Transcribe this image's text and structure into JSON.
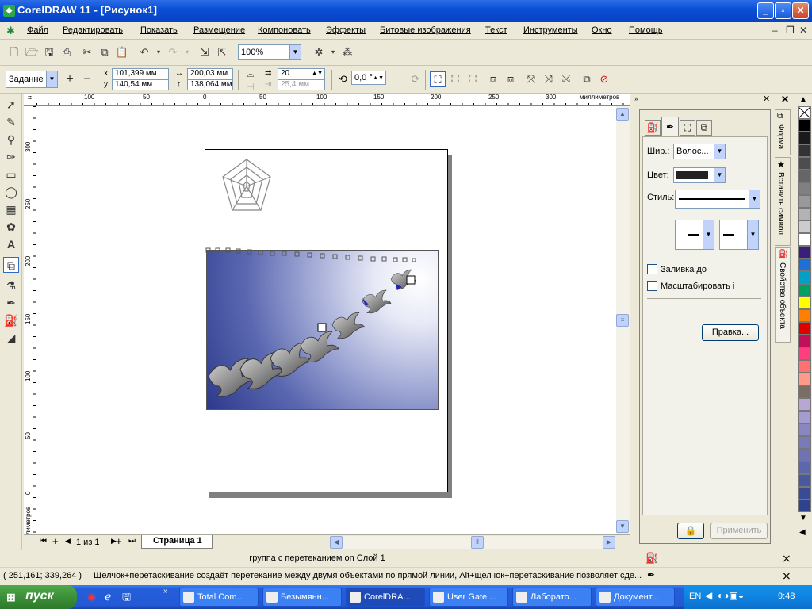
{
  "window": {
    "title": "CorelDRAW 11 - [Рисунок1]",
    "min": "_",
    "max": "▫",
    "close": "✕"
  },
  "menu": [
    "Файл",
    "Редактировать",
    "Показать",
    "Размещение",
    "Компоновать",
    "Эффекты",
    "Битовые изображения",
    "Текст",
    "Инструменты",
    "Окно",
    "Помощь"
  ],
  "toolbar": {
    "zoom": "100%"
  },
  "propbar": {
    "preset": "Заданне",
    "x_label": "x:",
    "x": "101,399 мм",
    "y_label": "y:",
    "y": "140,54 мм",
    "width": "200,03 мм",
    "height": "138,064 мм",
    "steps": "20",
    "spacing": "25,4 мм",
    "rotation": "0,0",
    "rotation_unit": "°"
  },
  "ruler": {
    "unit": "миллиметров",
    "h_ticks": [
      "100",
      "50",
      "0",
      "50",
      "100",
      "150",
      "200",
      "250",
      "300"
    ],
    "v_ticks": [
      "300",
      "250",
      "200",
      "150",
      "100",
      "50",
      "0"
    ],
    "v_unit": "миллиметров"
  },
  "pagebar": {
    "count": "1 из 1",
    "tab": "Страница 1"
  },
  "docker": {
    "width_label": "Шир.:",
    "width_value": "Волос...",
    "color_label": "Цвет:",
    "style_label": "Стиль:",
    "fill_label": "Заливка до",
    "scale_label": "Масштабировать і",
    "edit_button": "Правка...",
    "apply_button": "Применить",
    "tabs": [
      "Форма",
      "Вставить символ",
      "Свойства объекта"
    ]
  },
  "palette": [
    "#ffffff",
    "#000000",
    "#1a1a1a",
    "#333333",
    "#4d4d4d",
    "#666666",
    "#808080",
    "#999999",
    "#b3b3b3",
    "#cccccc",
    "#ffffff",
    "#3a1f7a",
    "#1f6fd6",
    "#00a0c8",
    "#00a060",
    "#ffff00",
    "#ff8000",
    "#e00000",
    "#c0105a",
    "#ff3d7f",
    "#ff7070",
    "#ff9a8a",
    "#7a6e64",
    "#b8a6d4",
    "#a49ccf",
    "#8a86c2",
    "#7a7ab8",
    "#6f73b3",
    "#5d67ac",
    "#4a589f",
    "#3a4b95",
    "#2f428c"
  ],
  "status": {
    "object": "группа с перетеканием on Слой 1",
    "coords": "( 251,161; 339,264 )",
    "hint": "Щелчок+перетаскивание создаёт перетекание между двумя объектами по прямой линии, Alt+щелчок+перетаскивание позволяет сде..."
  },
  "taskbar": {
    "start": "пуск",
    "tasks": [
      "Total Com...",
      "Безымянн...",
      "CorelDRA...",
      "User Gate ...",
      "Лаборато...",
      "Документ..."
    ],
    "lang": "EN",
    "clock": "9:48"
  }
}
